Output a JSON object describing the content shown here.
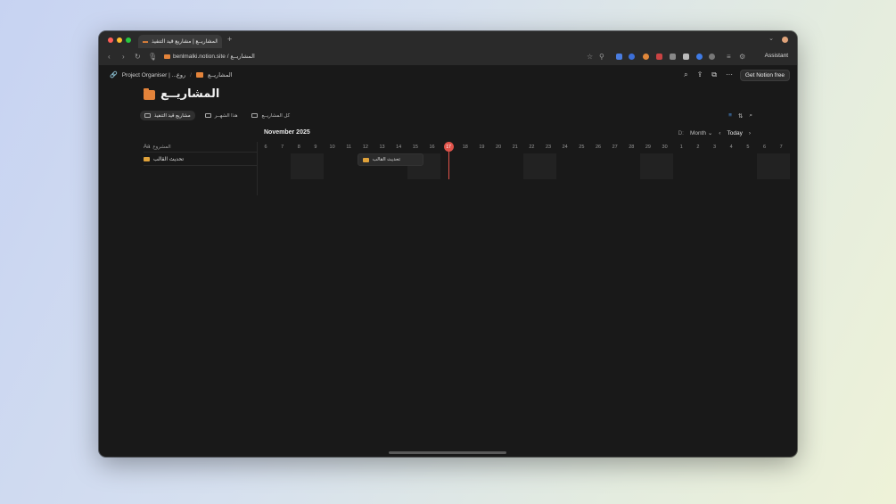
{
  "browser": {
    "tab_title": "المشاريــع | مشاريع قيد التنفيذ",
    "url": "benlmalki.notion.site / المشاريــع",
    "assistant_label": "Assistant"
  },
  "breadcrumb": {
    "parent": "Project Organiser | ...روع",
    "current": "المشاريــع"
  },
  "header": {
    "get_notion_label": "Get Notion free"
  },
  "page": {
    "title": "المشاريــع"
  },
  "views": [
    {
      "label": "مشاريع قيد التنفيذ",
      "active": true
    },
    {
      "label": "هذا الشهــر",
      "active": false
    },
    {
      "label": "كل المشاريــع",
      "active": false
    }
  ],
  "timeline": {
    "month_label": "November 2025",
    "d_label": "D:",
    "scale_label": "Month",
    "today_label": "Today",
    "column_header": "المشروع",
    "column_header_icon": "Aa",
    "rows": [
      {
        "name": "تحديث القالب"
      }
    ],
    "bar_label": "تحديث القالب",
    "days": [
      "6",
      "7",
      "8",
      "9",
      "10",
      "11",
      "12",
      "13",
      "14",
      "15",
      "16",
      "17",
      "18",
      "19",
      "20",
      "21",
      "22",
      "23",
      "24",
      "25",
      "26",
      "27",
      "28",
      "29",
      "30",
      "1",
      "2",
      "3",
      "4",
      "5",
      "6",
      "7"
    ],
    "today_index": 11
  },
  "colors": {
    "accent_red": "#e0534a",
    "folder_orange": "#e3833a",
    "filter_blue": "#4d9bf0"
  }
}
